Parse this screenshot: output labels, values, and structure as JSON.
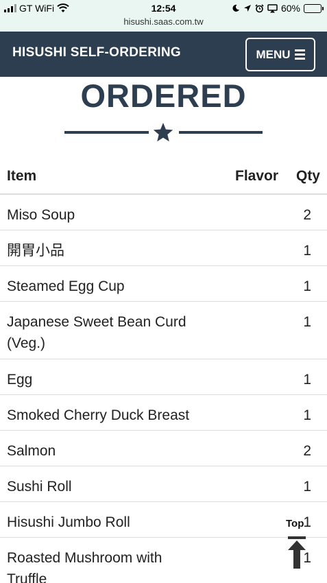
{
  "status_bar": {
    "carrier": "GT WiFi",
    "time": "12:54",
    "battery": "60%",
    "battery_level": 0.6,
    "url": "hisushi.saas.com.tw"
  },
  "navbar": {
    "brand": "HISUSHI SELF-ORDERING",
    "menu_label": "MENU"
  },
  "page": {
    "heading": "ORDERED"
  },
  "table": {
    "headers": {
      "item": "Item",
      "flavor": "Flavor",
      "qty": "Qty"
    },
    "rows": [
      {
        "item": "Miso Soup",
        "flavor": "",
        "qty": "2"
      },
      {
        "item": "開胃小品",
        "flavor": "",
        "qty": "1"
      },
      {
        "item": "Steamed Egg Cup",
        "flavor": "",
        "qty": "1"
      },
      {
        "item": "Japanese Sweet Bean Curd (Veg.)",
        "flavor": "",
        "qty": "1"
      },
      {
        "item": "Egg",
        "flavor": "",
        "qty": "1"
      },
      {
        "item": "Smoked Cherry Duck Breast",
        "flavor": "",
        "qty": "1"
      },
      {
        "item": "Salmon",
        "flavor": "",
        "qty": "2"
      },
      {
        "item": "Sushi Roll",
        "flavor": "",
        "qty": "1"
      },
      {
        "item": "Hisushi Jumbo Roll",
        "flavor": "",
        "qty": "1"
      },
      {
        "item": "Roasted Mushroom with Truffle",
        "flavor": "",
        "qty": "1"
      }
    ]
  },
  "back_to_top": {
    "label": "Top"
  },
  "colors": {
    "primary": "#2c3e50",
    "status_bg": "#e9f6f2",
    "border": "#dddddd"
  }
}
